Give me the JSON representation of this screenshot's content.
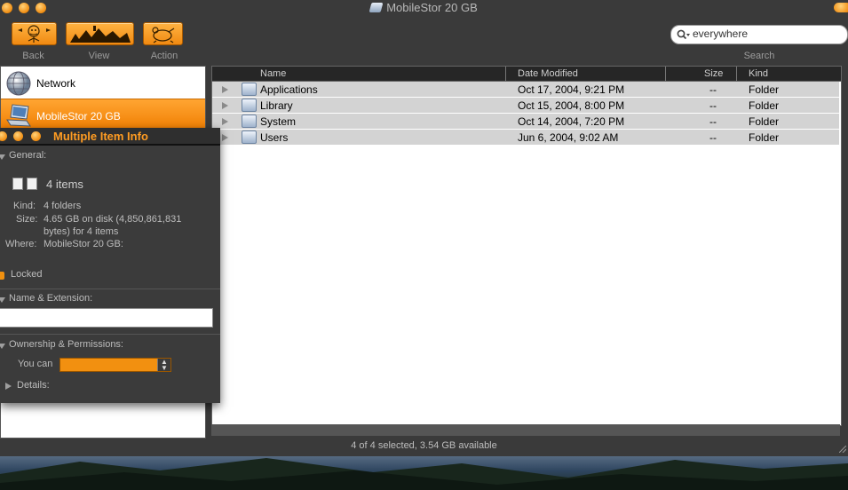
{
  "window": {
    "title": "MobileStor 20 GB"
  },
  "toolbar": {
    "back_label": "Back",
    "view_label": "View",
    "action_label": "Action",
    "search_label": "Search"
  },
  "search": {
    "value": "everywhere"
  },
  "sidebar": {
    "items": [
      {
        "label": "Network",
        "icon": "network-globe-icon"
      },
      {
        "label": "MobileStor 20 GB",
        "icon": "laptop-disk-icon",
        "selected": true
      }
    ]
  },
  "filelist": {
    "columns": [
      "Name",
      "Date Modified",
      "Size",
      "Kind"
    ],
    "rows": [
      {
        "name": "Applications",
        "date": "Oct 17, 2004, 9:21 PM",
        "size": "--",
        "kind": "Folder"
      },
      {
        "name": "Library",
        "date": "Oct 15, 2004, 8:00 PM",
        "size": "--",
        "kind": "Folder"
      },
      {
        "name": "System",
        "date": "Oct 14, 2004, 7:20 PM",
        "size": "--",
        "kind": "Folder"
      },
      {
        "name": "Users",
        "date": "Jun 6, 2004, 9:02 AM",
        "size": "--",
        "kind": "Folder"
      }
    ]
  },
  "status": {
    "text": "4 of 4 selected, 3.54 GB available"
  },
  "info_panel": {
    "title": "Multiple Item Info",
    "general_label": "General:",
    "count": "4 items",
    "kind_key": "Kind:",
    "kind_val": "4 folders",
    "size_key": "Size:",
    "size_val_1": "4.65 GB on disk (4,850,861,831",
    "size_val_2": "bytes) for 4 items",
    "where_key": "Where:",
    "where_val": "MobileStor 20 GB:",
    "locked_label": "Locked",
    "name_ext_label": "Name & Extension:",
    "ownership_label": "Ownership & Permissions:",
    "you_can_label": "You can",
    "details_label": "Details:"
  },
  "colors": {
    "accent": "#f08c10",
    "selection": "#d3d3d3",
    "chrome": "#3a3a3a"
  }
}
